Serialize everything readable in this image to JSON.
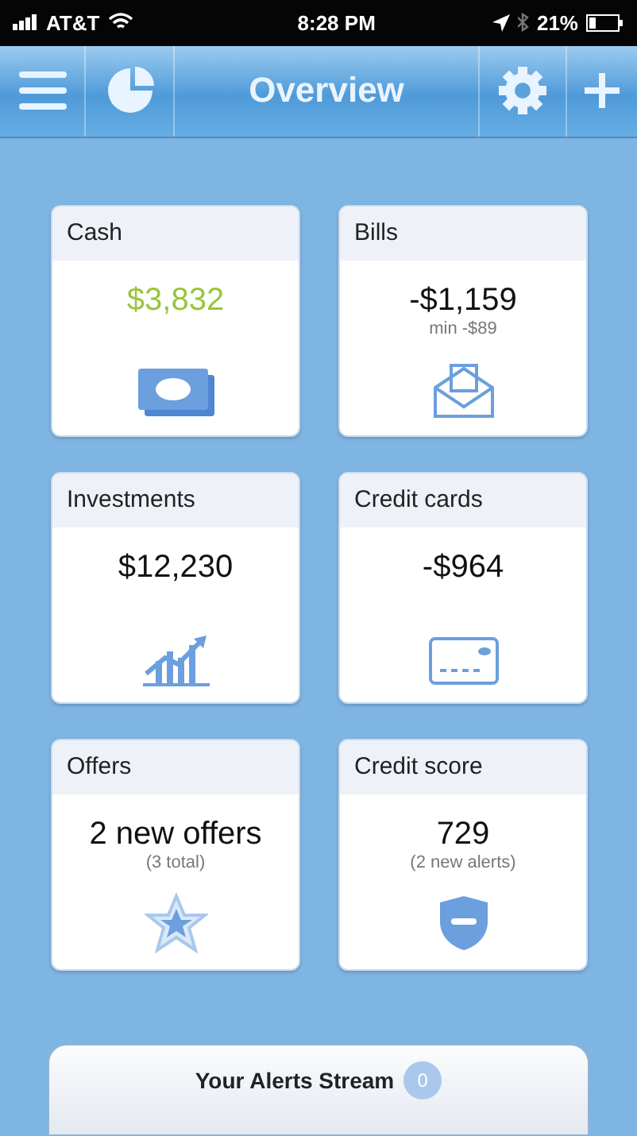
{
  "status_bar": {
    "carrier": "AT&T",
    "time": "8:28 PM",
    "battery": "21%"
  },
  "nav_bar": {
    "title": "Overview"
  },
  "cards": [
    {
      "kind": "cash",
      "title": "Cash",
      "amount": "$3,832",
      "highlight": true
    },
    {
      "kind": "bills",
      "title": "Bills",
      "amount": "-$1,159",
      "note": "min -$89",
      "highlight": false
    },
    {
      "kind": "investments",
      "title": "Investments",
      "amount": "$12,230",
      "highlight": false
    },
    {
      "kind": "credit_cards",
      "title": "Credit cards",
      "amount": "-$964",
      "highlight": false
    },
    {
      "kind": "offers",
      "title": "Offers",
      "amount": "2 new offers",
      "note": "(3 total)",
      "highlight": false
    },
    {
      "kind": "credit_score",
      "title": "Credit score",
      "amount": "729",
      "note": "(2 new alerts)",
      "highlight": false
    }
  ],
  "alerts_bar": {
    "label": "Your Alerts Stream",
    "count": "0"
  }
}
